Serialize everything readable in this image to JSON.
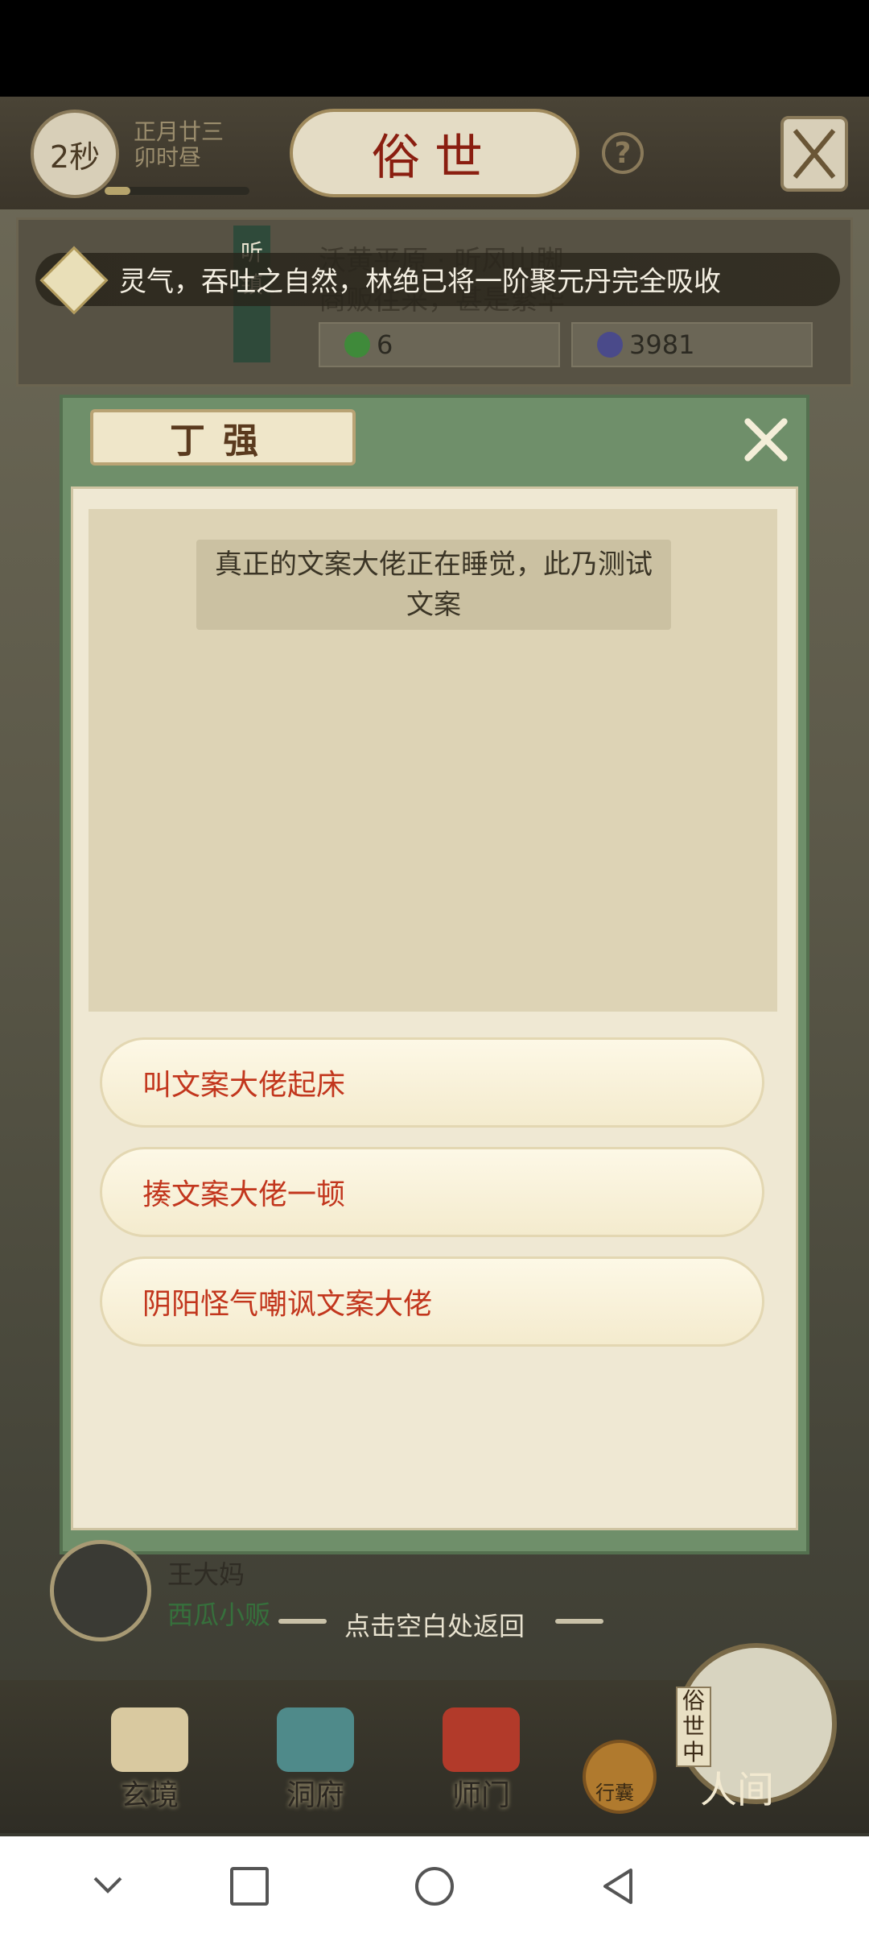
{
  "status_bar": {
    "background": "#000000"
  },
  "top_bar": {
    "timer": "2秒",
    "date_line1": "正月廿三",
    "date_line2": "卯时昼",
    "title": "俗世",
    "help": "?"
  },
  "location": {
    "town_tag": "听镇",
    "text_line1": "沃黄平原 · 听风山脚",
    "text_line2": "商贩往来，甚是繁华",
    "resource_jade": "6",
    "resource_stone": "3981"
  },
  "banner": {
    "icon": "lantern-icon",
    "message": "灵气，吞吐之自然，林绝已将一阶聚元丹完全吸收"
  },
  "dialog": {
    "npc_name": "丁强",
    "close_icon": "close-icon",
    "speech": "真正的文案大佬正在睡觉，此乃测试文案",
    "options": [
      "叫文案大佬起床",
      "揍文案大佬一顿",
      "阴阳怪气嘲讽文案大佬"
    ],
    "return_hint": "点击空白处返回"
  },
  "npc_row": {
    "name": "王大妈",
    "role": "西瓜小贩"
  },
  "bottom_nav": {
    "items": [
      "玄境",
      "洞府",
      "师门"
    ],
    "bag_label": "行囊",
    "current": "人间",
    "current_tag": "俗世中"
  },
  "system_nav": {
    "icons": [
      "back-chevron-icon",
      "recents-icon",
      "home-icon",
      "back-triangle-icon"
    ]
  },
  "colors": {
    "accent_red": "#c2361d",
    "dialog_green": "#6f8f6a",
    "paper": "#efe8d3",
    "title_red": "#8a1e10"
  }
}
